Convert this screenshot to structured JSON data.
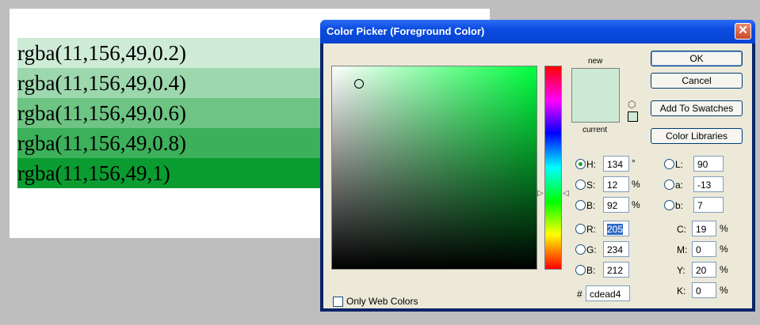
{
  "document": {
    "rows": [
      {
        "text": "rgba(11,156,49,0.2)",
        "color": "rgba(11,156,49,0.2)"
      },
      {
        "text": "rgba(11,156,49,0.4)",
        "color": "rgba(11,156,49,0.4)"
      },
      {
        "text": "rgba(11,156,49,0.6)",
        "color": "rgba(11,156,49,0.6)"
      },
      {
        "text": "rgba(11,156,49,0.8)",
        "color": "rgba(11,156,49,0.8)"
      },
      {
        "text": "rgba(11,156,49,1)",
        "color": "rgba(11,156,49,1)"
      }
    ]
  },
  "dialog": {
    "title": "Color Picker (Foreground Color)",
    "close_glyph": "✕",
    "new_label": "new",
    "current_label": "current",
    "preview_color": "#cdead4",
    "buttons": {
      "ok": "OK",
      "cancel": "Cancel",
      "add_to_swatches": "Add To Swatches",
      "color_libraries": "Color Libraries"
    },
    "hsb": {
      "h_label": "H:",
      "h_value": "134",
      "h_unit": "°",
      "s_label": "S:",
      "s_value": "12",
      "s_unit": "%",
      "b_label": "B:",
      "b_value": "92",
      "b_unit": "%"
    },
    "rgb": {
      "r_label": "R:",
      "r_value": "205",
      "g_label": "G:",
      "g_value": "234",
      "b_label": "B:",
      "b_value": "212"
    },
    "lab": {
      "l_label": "L:",
      "l_value": "90",
      "a_label": "a:",
      "a_value": "-13",
      "b_label": "b:",
      "b_value": "7"
    },
    "cmyk": {
      "c_label": "C:",
      "c_value": "19",
      "c_unit": "%",
      "m_label": "M:",
      "m_value": "0",
      "m_unit": "%",
      "y_label": "Y:",
      "y_value": "20",
      "y_unit": "%",
      "k_label": "K:",
      "k_value": "0",
      "k_unit": "%"
    },
    "hex_label": "#",
    "hex_value": "cdead4",
    "only_web_colors": "Only Web Colors",
    "selected_mode": "H"
  }
}
